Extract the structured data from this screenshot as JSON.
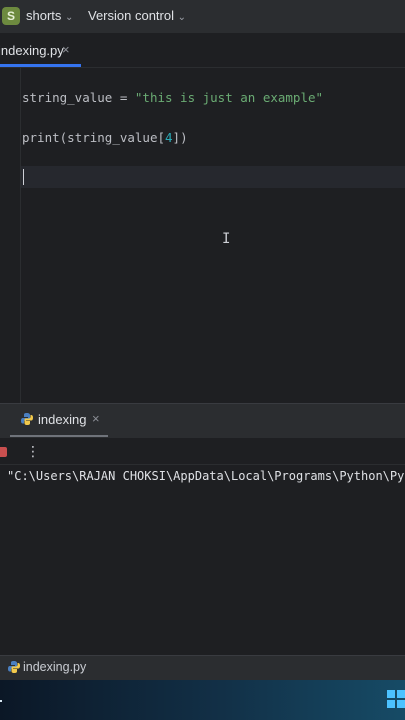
{
  "titlebar": {
    "project_initial": "S",
    "project_name": "shorts",
    "vcs_label": "Version control"
  },
  "tabs": [
    {
      "label": "indexing.py",
      "active": true
    }
  ],
  "editor": {
    "line1": {
      "identifier": "string_value",
      "operator": " = ",
      "string": "\"this is just an example\""
    },
    "line2": {
      "function": "print",
      "open": "(",
      "identifier": "string_value",
      "bracket_open": "[",
      "index": "4",
      "bracket_close": "])"
    }
  },
  "run_window": {
    "tab_label": "indexing",
    "console_text": "\"C:\\Users\\RAJAN CHOKSI\\AppData\\Local\\Programs\\Python\\Py"
  },
  "statusbar": {
    "file_label": "indexing.py"
  },
  "colors": {
    "accent": "#3574f0",
    "string": "#6aab73",
    "number": "#2aacb8",
    "stop": "#c94f4f"
  }
}
